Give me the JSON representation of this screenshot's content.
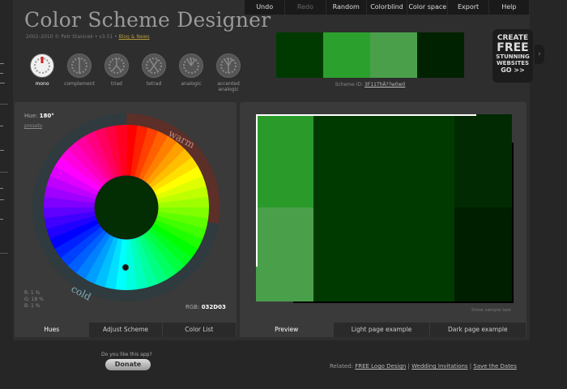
{
  "app": {
    "title": "Color Scheme Designer",
    "byline_text": "2002–2010 © Petr Stanicek • v3.51 •",
    "byline_link": "Blog & News"
  },
  "menu": {
    "items": [
      {
        "label": "Undo",
        "enabled": true
      },
      {
        "label": "Redo",
        "enabled": false
      },
      {
        "label": "Random",
        "enabled": true
      },
      {
        "label": "Colorblind",
        "enabled": true
      },
      {
        "label": "Color space",
        "enabled": true
      },
      {
        "label": "Export",
        "enabled": true
      },
      {
        "label": "Help",
        "enabled": true
      }
    ]
  },
  "swatches": [
    "#003a00",
    "#2ca02c",
    "#4aa04a",
    "#002200"
  ],
  "scheme": {
    "label": "Scheme ID:",
    "id": "3F11ThÄ??w0w0"
  },
  "ad": {
    "line1": "CREATE",
    "line2": "FREE",
    "line3": "STUNNING",
    "line4": "WEBSITES",
    "line5": "GO >>"
  },
  "modes": [
    {
      "label": "mono",
      "selected": true,
      "icon": "mono-icon"
    },
    {
      "label": "complement",
      "selected": false,
      "icon": "complement-icon"
    },
    {
      "label": "triad",
      "selected": false,
      "icon": "triad-icon"
    },
    {
      "label": "tetrad",
      "selected": false,
      "icon": "tetrad-icon"
    },
    {
      "label": "analogic",
      "selected": false,
      "icon": "analogic-icon"
    },
    {
      "label": "accented analogic",
      "selected": false,
      "icon": "accented-analogic-icon"
    }
  ],
  "wheel": {
    "hue_label": "Hue:",
    "hue_value": "180°",
    "presets_link": "presets",
    "warm_label": "warm",
    "cold_label": "cold",
    "center_color": "#032D03",
    "rgb_lines": [
      "R:  1 %",
      "G: 18 %",
      "B:  1 %"
    ],
    "rgb_label": "RGB:",
    "rgb_hex": "032D03"
  },
  "left_tabs": [
    {
      "label": "Hues",
      "active": true
    },
    {
      "label": "Adjust Scheme",
      "active": false
    },
    {
      "label": "Color List",
      "active": false
    }
  ],
  "right_tabs": [
    {
      "label": "Preview",
      "active": true
    },
    {
      "label": "Light page example",
      "active": false
    },
    {
      "label": "Dark page example",
      "active": false
    }
  ],
  "preview": {
    "colors": {
      "bright_a": "#2a9a2a",
      "bright_b": "#4aa04a",
      "base": "#003a00",
      "dark_a": "#022a02",
      "dark_b": "#001e00"
    },
    "show_sample_text": "Show sample text"
  },
  "donate": {
    "question": "Do you like this app?",
    "button": "Donate"
  },
  "related": {
    "label": "Related:",
    "links": [
      "FREE Logo Design",
      "Wedding Invitations",
      "Save the Dates"
    ]
  }
}
